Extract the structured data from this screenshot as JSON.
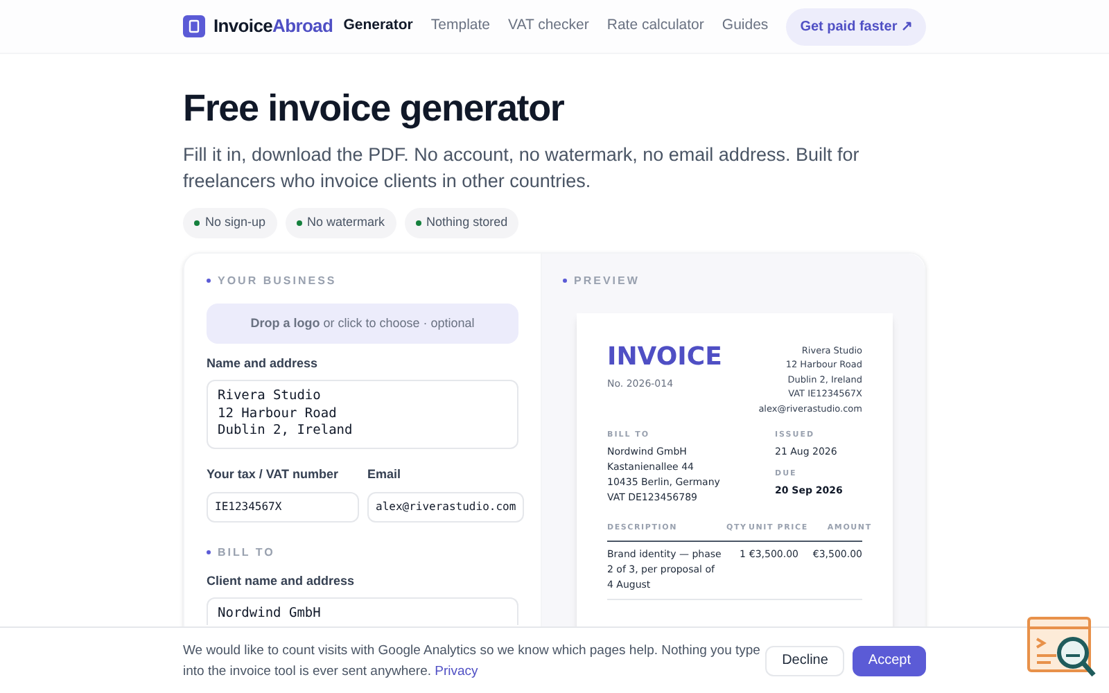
{
  "header": {
    "logo_first": "Invoice",
    "logo_second": "Abroad",
    "nav": [
      {
        "label": "Generator",
        "selected": true
      },
      {
        "label": "Template",
        "selected": false
      },
      {
        "label": "VAT checker",
        "selected": false
      },
      {
        "label": "Rate calculator",
        "selected": false
      },
      {
        "label": "Guides",
        "selected": false
      }
    ],
    "cta": "Get paid faster ↗"
  },
  "hero": {
    "title": "Free invoice generator",
    "subtitle": "Fill it in, download the PDF. No account, no watermark, no email address. Built for freelancers who invoice clients in other countries.",
    "pills": [
      {
        "label": "No sign-up",
        "color": "#15803d"
      },
      {
        "label": "No watermark",
        "color": "#15803d"
      },
      {
        "label": "Nothing stored",
        "color": "#15803d"
      }
    ]
  },
  "form": {
    "sections": [
      {
        "title": "YOUR BUSINESS",
        "fields": [
          {
            "kind": "dropzone",
            "text": "**Drop a logo** or click to choose · optional"
          },
          {
            "kind": "textarea",
            "label": "Name and address",
            "value": "Rivera Studio\n12 Harbour Road\nDublin 2, Ireland"
          },
          {
            "kind": "pair",
            "items": [
              {
                "label": "Your tax / VAT number",
                "value": "IE1234567X"
              },
              {
                "label": "Email",
                "value": "alex@riverastudio.com"
              }
            ]
          }
        ]
      },
      {
        "title": "BILL TO",
        "fields": [
          {
            "kind": "textarea",
            "label": "Client name and address",
            "value": "Nordwind GmbH"
          }
        ]
      }
    ]
  },
  "preview": {
    "title": "PREVIEW",
    "invoice": {
      "heading": "INVOICE",
      "number": "No. 2026-014",
      "from": [
        "Rivera Studio",
        "12 Harbour Road",
        "Dublin 2, Ireland",
        "VAT IE1234567X",
        "alex@riverastudio.com"
      ],
      "bill_to_label": "BILL TO",
      "bill_to": [
        "Nordwind GmbH",
        "Kastanienallee 44",
        "10435 Berlin, Germany",
        "VAT DE123456789"
      ],
      "issued_label": "ISSUED",
      "issued": "21 Aug 2026",
      "due_label": "DUE",
      "due": "20 Sep 2026",
      "columns": [
        "DESCRIPTION",
        "QTY",
        "UNIT PRICE",
        "AMOUNT"
      ],
      "rows": [
        [
          "Brand identity — phase 2 of 3, per proposal of 4 August",
          "1",
          "€3,500.00",
          "€3,500.00"
        ]
      ]
    }
  },
  "cookie_banner": {
    "text": "We would like to count visits with Google Analytics so we know which pages help. Nothing you type into the invoice tool is ever sent anywhere.",
    "link": "Privacy",
    "buttons": [
      {
        "label": "Decline",
        "kind": "secondary"
      },
      {
        "label": "Accept",
        "kind": "primary"
      }
    ]
  }
}
